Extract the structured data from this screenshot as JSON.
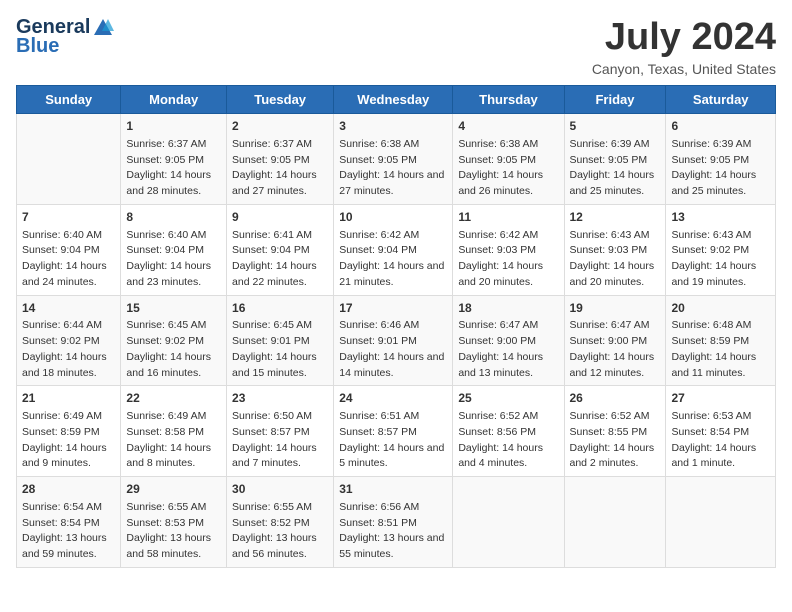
{
  "header": {
    "logo_line1": "General",
    "logo_line2": "Blue",
    "month": "July 2024",
    "location": "Canyon, Texas, United States"
  },
  "days_of_week": [
    "Sunday",
    "Monday",
    "Tuesday",
    "Wednesday",
    "Thursday",
    "Friday",
    "Saturday"
  ],
  "weeks": [
    [
      {
        "day": "",
        "sunrise": "",
        "sunset": "",
        "daylight": ""
      },
      {
        "day": "1",
        "sunrise": "Sunrise: 6:37 AM",
        "sunset": "Sunset: 9:05 PM",
        "daylight": "Daylight: 14 hours and 28 minutes."
      },
      {
        "day": "2",
        "sunrise": "Sunrise: 6:37 AM",
        "sunset": "Sunset: 9:05 PM",
        "daylight": "Daylight: 14 hours and 27 minutes."
      },
      {
        "day": "3",
        "sunrise": "Sunrise: 6:38 AM",
        "sunset": "Sunset: 9:05 PM",
        "daylight": "Daylight: 14 hours and 27 minutes."
      },
      {
        "day": "4",
        "sunrise": "Sunrise: 6:38 AM",
        "sunset": "Sunset: 9:05 PM",
        "daylight": "Daylight: 14 hours and 26 minutes."
      },
      {
        "day": "5",
        "sunrise": "Sunrise: 6:39 AM",
        "sunset": "Sunset: 9:05 PM",
        "daylight": "Daylight: 14 hours and 25 minutes."
      },
      {
        "day": "6",
        "sunrise": "Sunrise: 6:39 AM",
        "sunset": "Sunset: 9:05 PM",
        "daylight": "Daylight: 14 hours and 25 minutes."
      }
    ],
    [
      {
        "day": "7",
        "sunrise": "Sunrise: 6:40 AM",
        "sunset": "Sunset: 9:04 PM",
        "daylight": "Daylight: 14 hours and 24 minutes."
      },
      {
        "day": "8",
        "sunrise": "Sunrise: 6:40 AM",
        "sunset": "Sunset: 9:04 PM",
        "daylight": "Daylight: 14 hours and 23 minutes."
      },
      {
        "day": "9",
        "sunrise": "Sunrise: 6:41 AM",
        "sunset": "Sunset: 9:04 PM",
        "daylight": "Daylight: 14 hours and 22 minutes."
      },
      {
        "day": "10",
        "sunrise": "Sunrise: 6:42 AM",
        "sunset": "Sunset: 9:04 PM",
        "daylight": "Daylight: 14 hours and 21 minutes."
      },
      {
        "day": "11",
        "sunrise": "Sunrise: 6:42 AM",
        "sunset": "Sunset: 9:03 PM",
        "daylight": "Daylight: 14 hours and 20 minutes."
      },
      {
        "day": "12",
        "sunrise": "Sunrise: 6:43 AM",
        "sunset": "Sunset: 9:03 PM",
        "daylight": "Daylight: 14 hours and 20 minutes."
      },
      {
        "day": "13",
        "sunrise": "Sunrise: 6:43 AM",
        "sunset": "Sunset: 9:02 PM",
        "daylight": "Daylight: 14 hours and 19 minutes."
      }
    ],
    [
      {
        "day": "14",
        "sunrise": "Sunrise: 6:44 AM",
        "sunset": "Sunset: 9:02 PM",
        "daylight": "Daylight: 14 hours and 18 minutes."
      },
      {
        "day": "15",
        "sunrise": "Sunrise: 6:45 AM",
        "sunset": "Sunset: 9:02 PM",
        "daylight": "Daylight: 14 hours and 16 minutes."
      },
      {
        "day": "16",
        "sunrise": "Sunrise: 6:45 AM",
        "sunset": "Sunset: 9:01 PM",
        "daylight": "Daylight: 14 hours and 15 minutes."
      },
      {
        "day": "17",
        "sunrise": "Sunrise: 6:46 AM",
        "sunset": "Sunset: 9:01 PM",
        "daylight": "Daylight: 14 hours and 14 minutes."
      },
      {
        "day": "18",
        "sunrise": "Sunrise: 6:47 AM",
        "sunset": "Sunset: 9:00 PM",
        "daylight": "Daylight: 14 hours and 13 minutes."
      },
      {
        "day": "19",
        "sunrise": "Sunrise: 6:47 AM",
        "sunset": "Sunset: 9:00 PM",
        "daylight": "Daylight: 14 hours and 12 minutes."
      },
      {
        "day": "20",
        "sunrise": "Sunrise: 6:48 AM",
        "sunset": "Sunset: 8:59 PM",
        "daylight": "Daylight: 14 hours and 11 minutes."
      }
    ],
    [
      {
        "day": "21",
        "sunrise": "Sunrise: 6:49 AM",
        "sunset": "Sunset: 8:59 PM",
        "daylight": "Daylight: 14 hours and 9 minutes."
      },
      {
        "day": "22",
        "sunrise": "Sunrise: 6:49 AM",
        "sunset": "Sunset: 8:58 PM",
        "daylight": "Daylight: 14 hours and 8 minutes."
      },
      {
        "day": "23",
        "sunrise": "Sunrise: 6:50 AM",
        "sunset": "Sunset: 8:57 PM",
        "daylight": "Daylight: 14 hours and 7 minutes."
      },
      {
        "day": "24",
        "sunrise": "Sunrise: 6:51 AM",
        "sunset": "Sunset: 8:57 PM",
        "daylight": "Daylight: 14 hours and 5 minutes."
      },
      {
        "day": "25",
        "sunrise": "Sunrise: 6:52 AM",
        "sunset": "Sunset: 8:56 PM",
        "daylight": "Daylight: 14 hours and 4 minutes."
      },
      {
        "day": "26",
        "sunrise": "Sunrise: 6:52 AM",
        "sunset": "Sunset: 8:55 PM",
        "daylight": "Daylight: 14 hours and 2 minutes."
      },
      {
        "day": "27",
        "sunrise": "Sunrise: 6:53 AM",
        "sunset": "Sunset: 8:54 PM",
        "daylight": "Daylight: 14 hours and 1 minute."
      }
    ],
    [
      {
        "day": "28",
        "sunrise": "Sunrise: 6:54 AM",
        "sunset": "Sunset: 8:54 PM",
        "daylight": "Daylight: 13 hours and 59 minutes."
      },
      {
        "day": "29",
        "sunrise": "Sunrise: 6:55 AM",
        "sunset": "Sunset: 8:53 PM",
        "daylight": "Daylight: 13 hours and 58 minutes."
      },
      {
        "day": "30",
        "sunrise": "Sunrise: 6:55 AM",
        "sunset": "Sunset: 8:52 PM",
        "daylight": "Daylight: 13 hours and 56 minutes."
      },
      {
        "day": "31",
        "sunrise": "Sunrise: 6:56 AM",
        "sunset": "Sunset: 8:51 PM",
        "daylight": "Daylight: 13 hours and 55 minutes."
      },
      {
        "day": "",
        "sunrise": "",
        "sunset": "",
        "daylight": ""
      },
      {
        "day": "",
        "sunrise": "",
        "sunset": "",
        "daylight": ""
      },
      {
        "day": "",
        "sunrise": "",
        "sunset": "",
        "daylight": ""
      }
    ]
  ]
}
